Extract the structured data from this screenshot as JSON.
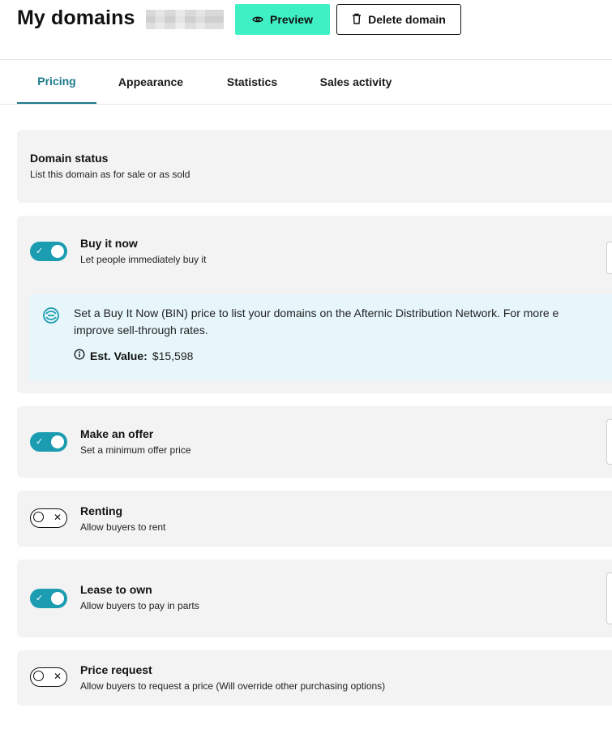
{
  "header": {
    "title": "My domains",
    "preview_label": "Preview",
    "delete_label": "Delete domain"
  },
  "tabs": [
    {
      "label": "Pricing",
      "active": true
    },
    {
      "label": "Appearance",
      "active": false
    },
    {
      "label": "Statistics",
      "active": false
    },
    {
      "label": "Sales activity",
      "active": false
    }
  ],
  "domain_status": {
    "title": "Domain status",
    "subtitle": "List this domain as for sale or as sold"
  },
  "options": {
    "buy_it_now": {
      "title": "Buy it now",
      "subtitle": "Let people immediately buy it",
      "enabled": true
    },
    "make_offer": {
      "title": "Make an offer",
      "subtitle": "Set a minimum offer price",
      "enabled": true
    },
    "renting": {
      "title": "Renting",
      "subtitle": "Allow buyers to rent",
      "enabled": false
    },
    "lease_to_own": {
      "title": "Lease to own",
      "subtitle": "Allow buyers to pay in parts",
      "enabled": true
    },
    "price_request": {
      "title": "Price request",
      "subtitle": "Allow buyers to request a price (Will override other purchasing options)",
      "enabled": false
    }
  },
  "bin_info": {
    "line1": "Set a Buy It Now (BIN) price to list your domains on the Afternic Distribution Network. For more e",
    "line2": "improve sell-through rates.",
    "est_label": "Est. Value:",
    "est_value": "$15,598"
  },
  "colors": {
    "preview_button": "#3ff0c4",
    "active_tab": "#1b7a8c",
    "toggle_on": "#1b9cb0",
    "card_bg": "#f3f3f4",
    "info_bg": "#e6f6fb"
  }
}
